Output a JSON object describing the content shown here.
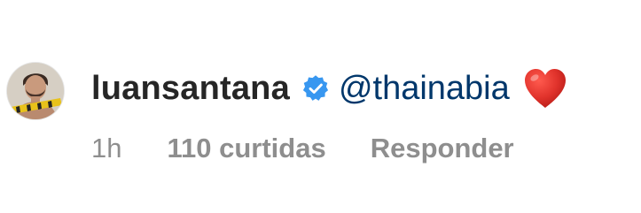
{
  "comment": {
    "username": "luansantana",
    "verified": true,
    "verified_badge_color": "#3897f0",
    "mention": "@thainabia",
    "emoji": "heart-emoji",
    "emoji_color": "#e0322b",
    "time": "1h",
    "likes": "110 curtidas",
    "reply_label": "Responder"
  },
  "colors": {
    "username": "#262626",
    "mention": "#00376b",
    "meta": "#8e8e8e"
  }
}
